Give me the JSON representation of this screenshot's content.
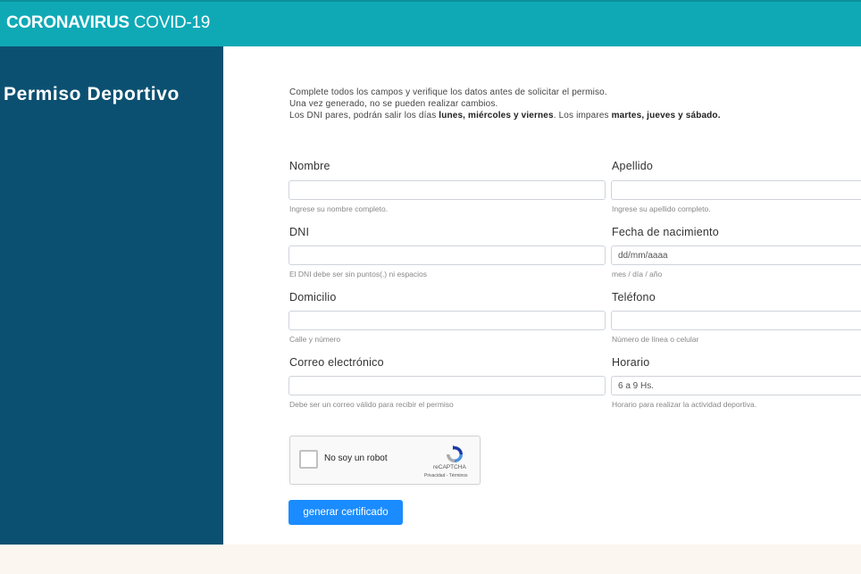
{
  "header": {
    "title_bold": "CORONAVIRUS",
    "title_light": "COVID-19"
  },
  "sidebar": {
    "title": "Permiso Deportivo"
  },
  "intro": {
    "line1": "Complete todos los campos y verifique los datos antes de solicitar el permiso.",
    "line2": "Una vez generado, no se pueden realizar cambios.",
    "line3_a": "Los DNI pares, podrán salir los días ",
    "line3_b": "lunes, miércoles y viernes",
    "line3_c": ". Los impares ",
    "line3_d": "martes, jueves y sábado."
  },
  "form": {
    "nombre": {
      "label": "Nombre",
      "value": "",
      "help": "Ingrese su nombre completo."
    },
    "apellido": {
      "label": "Apellido",
      "value": "",
      "help": "Ingrese su apellido completo."
    },
    "dni": {
      "label": "DNI",
      "value": "",
      "help": "El DNI debe ser sin puntos(.) ni espacios"
    },
    "fecha": {
      "label": "Fecha de nacimiento",
      "placeholder": "dd/mm/aaaa",
      "help": "mes / día / año"
    },
    "domicilio": {
      "label": "Domicilio",
      "value": "",
      "help": "Calle y número"
    },
    "telefono": {
      "label": "Teléfono",
      "value": "",
      "help": "Número de línea o celular"
    },
    "correo": {
      "label": "Correo electrónico",
      "value": "",
      "help": "Debe ser un correo válido para recibir el permiso"
    },
    "horario": {
      "label": "Horario",
      "value": "6 a 9 Hs.",
      "help": "Horario para realizar la actividad deportiva."
    }
  },
  "captcha": {
    "label": "No soy un robot",
    "brand": "reCAPTCHA",
    "links": "Privacidad - Términos",
    "icon": "recaptcha-icon"
  },
  "submit": {
    "label": "generar certificado"
  },
  "colors": {
    "header": "#0fa9b6",
    "sidebar": "#0c5071",
    "button": "#1a8cff",
    "background": "#fbf7f0"
  }
}
